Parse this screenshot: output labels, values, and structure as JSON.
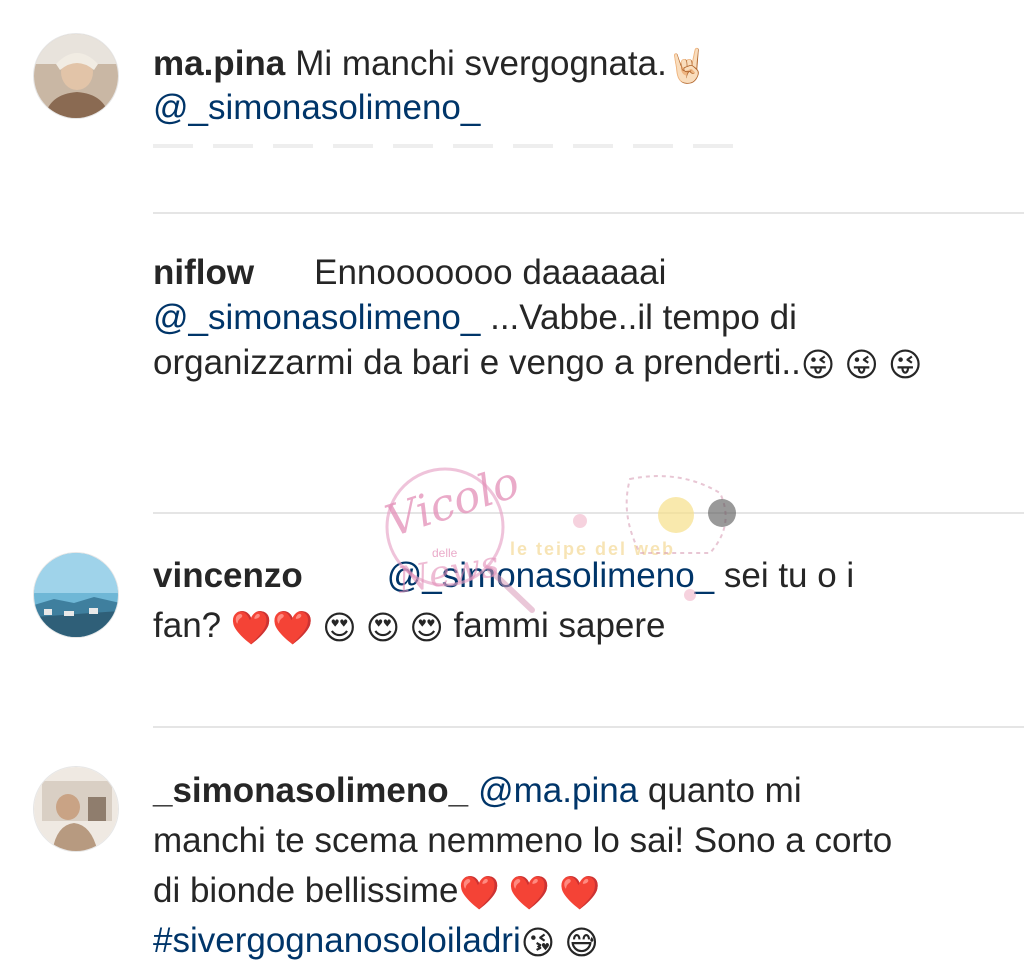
{
  "comments": [
    {
      "username": "ma.pina",
      "text": "Mi manchi svergognata.",
      "emoji": "🤘🏻",
      "mention": "@_simonasolimeno_"
    },
    {
      "username": "niflow",
      "text_start": "Ennooooooo daaaaaai",
      "mention": "@_simonasolimeno_",
      "text_end": "...Vabbe..il tempo di organizzarmi da bari e vengo a prenderti..",
      "emoji": "😜 😜 😜"
    },
    {
      "username": "vincenzo",
      "mention": "@_simonasolimeno_",
      "text_mid": "sei tu o i fan?",
      "emoji": "❤️❤️ 😍 😍 😍",
      "text_end": "fammi sapere"
    },
    {
      "username": "_simonasolimeno_",
      "mention": "@ma.pina",
      "text_mid": "quanto mi manchi te scema nemmeno lo sai! Sono a corto di bionde bellissime",
      "emoji_mid": "❤️ ❤️ ❤️",
      "hashtag": "#sivergognanosoloiladri",
      "emoji_end": "😘 😅"
    }
  ],
  "watermark": {
    "script_text": "Vicolo",
    "small_text": "delle",
    "script_text2": "News",
    "banner_text": "le teipe del web"
  },
  "colors": {
    "text": "#262626",
    "link": "#003569",
    "divider": "#e5e5e5",
    "watermark_pink": "#e6a3c6"
  }
}
